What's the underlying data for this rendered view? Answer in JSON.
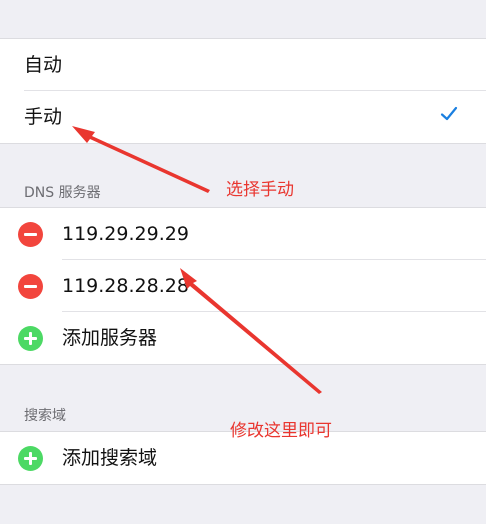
{
  "mode": {
    "auto_label": "自动",
    "manual_label": "手动",
    "selected": "manual"
  },
  "dns": {
    "header": "DNS 服务器",
    "servers": [
      "119.29.29.29",
      "119.28.28.28"
    ],
    "add_label": "添加服务器"
  },
  "search_domains": {
    "header": "搜索域",
    "add_label": "添加搜索域"
  },
  "annotations": {
    "select_manual": "选择手动",
    "edit_here": "修改这里即可"
  },
  "colors": {
    "background": "#efeff4",
    "remove": "#f2453d",
    "add": "#4cd964",
    "check": "#1a7fe0",
    "annotation": "#e9362f"
  },
  "icons": {
    "check": "checkmark-icon",
    "remove": "remove-circle-icon",
    "add": "add-circle-icon"
  }
}
